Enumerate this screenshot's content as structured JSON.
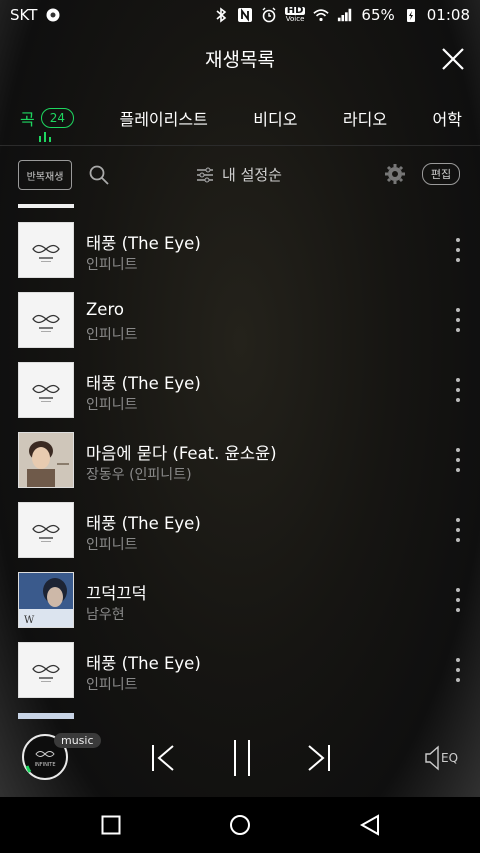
{
  "status_bar": {
    "carrier": "SKT",
    "hd_label": "HD",
    "hd_sub": "Voice",
    "battery": "65%",
    "time": "01:08"
  },
  "header": {
    "title": "재생목록"
  },
  "tabs": [
    {
      "label": "곡",
      "count": "24",
      "active": true
    },
    {
      "label": "플레이리스트"
    },
    {
      "label": "비디오"
    },
    {
      "label": "라디오"
    },
    {
      "label": "어학"
    }
  ],
  "toolbar": {
    "repeat_label": "반복재생",
    "sort_label": "내 설정순",
    "edit_label": "편집"
  },
  "tracks": [
    {
      "title": "태풍 (The Eye)",
      "artist": "인피니트",
      "art": "infinite"
    },
    {
      "title": "Zero",
      "artist": "인피니트",
      "art": "infinite"
    },
    {
      "title": "태풍 (The Eye)",
      "artist": "인피니트",
      "art": "infinite"
    },
    {
      "title": "마음에 묻다 (Feat. 윤소윤)",
      "artist": "장동우 (인피니트)",
      "art": "jang"
    },
    {
      "title": "태풍 (The Eye)",
      "artist": "인피니트",
      "art": "infinite"
    },
    {
      "title": "끄덕끄덕",
      "artist": "남우현",
      "art": "nam"
    },
    {
      "title": "태풍 (The Eye)",
      "artist": "인피니트",
      "art": "infinite"
    }
  ],
  "player": {
    "badge": "music",
    "eq_label": "EQ",
    "mini_art_text": "INFINITE"
  },
  "colors": {
    "accent": "#1ed760"
  }
}
